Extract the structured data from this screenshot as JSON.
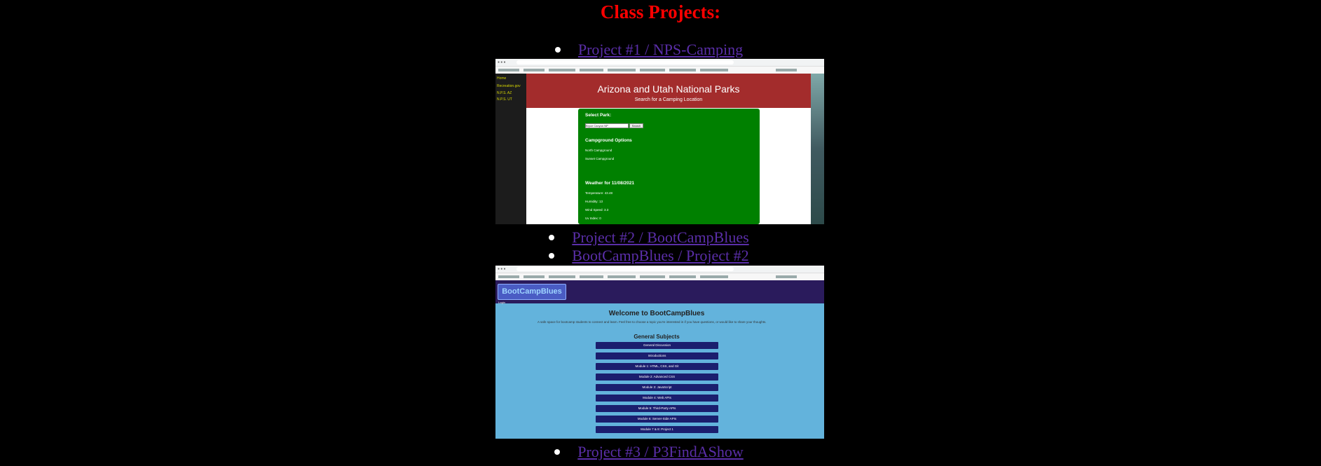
{
  "page": {
    "title": "Class Projects:"
  },
  "projects": [
    {
      "link": "Project #1 / NPS-Camping",
      "screenshot": {
        "sidebar": [
          "Home",
          "Recreation.gov",
          "N.P.S. AZ",
          "N.P.S. UT"
        ],
        "banner_title": "Arizona and Utah National Parks",
        "banner_subtitle": "Search for a Camping Location",
        "select_label": "Select Park:",
        "select_value": "Bryce Canyon NP",
        "search_button": "Search",
        "campground_heading": "Campground Options",
        "campgrounds": [
          "North Campground",
          "Sunset Campground"
        ],
        "weather_heading": "Weather for 11/08/2021",
        "weather": [
          "Temperature: 43.48",
          "Humidity: 13",
          "Wind Speed: 3.3",
          "Uv Index: 0"
        ]
      }
    },
    {
      "link": "Project #2 / BootCampBlues"
    },
    {
      "link": "BootCampBlues / Project #2",
      "screenshot": {
        "brand": "BootCampBlues",
        "login": "Login",
        "welcome": "Welcome to BootCampBlues",
        "description": "A safe space for bootcamp students to connect and learn. Feel free to choose a topic you're interested in if you have questions, or would like to share your thoughts.",
        "section_heading": "General Subjects",
        "subjects": [
          "General Discussion",
          "Introductions",
          "Module 1: HTML, CSS, and Git",
          "Module 2: Advanced CSS",
          "Module 3: JavaScript",
          "Module 4: Web APIs",
          "Module 5: Third-Party APIs",
          "Module 6: Server-Side APIs",
          "Module 7 & 8: Project 1"
        ]
      }
    },
    {
      "link": "Project #3 / P3FindAShow"
    }
  ]
}
